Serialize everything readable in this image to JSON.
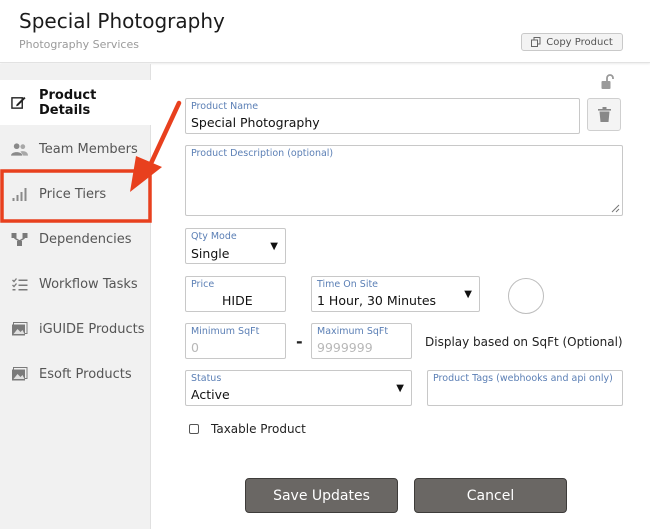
{
  "header": {
    "title": "Special Photography",
    "subtitle": "Photography Services",
    "copy_button": "Copy Product"
  },
  "sidebar": {
    "items": [
      {
        "label": "Product Details",
        "icon": "edit-icon",
        "active": true
      },
      {
        "label": "Team Members",
        "icon": "users-icon"
      },
      {
        "label": "Price Tiers",
        "icon": "signal-bars-icon"
      },
      {
        "label": "Dependencies",
        "icon": "hierarchy-icon"
      },
      {
        "label": "Workflow Tasks",
        "icon": "task-list-icon"
      },
      {
        "label": "iGUIDE Products",
        "icon": "image-icon"
      },
      {
        "label": "Esoft Products",
        "icon": "image-icon"
      }
    ]
  },
  "form": {
    "product_name": {
      "label": "Product Name",
      "value": "Special Photography"
    },
    "description": {
      "label": "Product Description (optional)",
      "value": ""
    },
    "qty_mode": {
      "label": "Qty Mode",
      "value": "Single"
    },
    "price": {
      "label": "Price",
      "value": "HIDE"
    },
    "time_on_site": {
      "label": "Time On Site",
      "value": "1 Hour, 30 Minutes"
    },
    "min_sqft": {
      "label": "Minimum SqFt",
      "placeholder": "0"
    },
    "max_sqft": {
      "label": "Maximum SqFt",
      "placeholder": "9999999"
    },
    "sqft_separator": "-",
    "sqft_note": "Display based on SqFt (Optional)",
    "status": {
      "label": "Status",
      "value": "Active"
    },
    "tags": {
      "label": "Product Tags (webhooks and api only)",
      "value": ""
    },
    "taxable_label": "Taxable Product"
  },
  "actions": {
    "save": "Save Updates",
    "cancel": "Cancel"
  },
  "colors": {
    "accent_label": "#5b7fb5",
    "button_bg": "#6a6764",
    "annotation_red": "#e8401e"
  }
}
